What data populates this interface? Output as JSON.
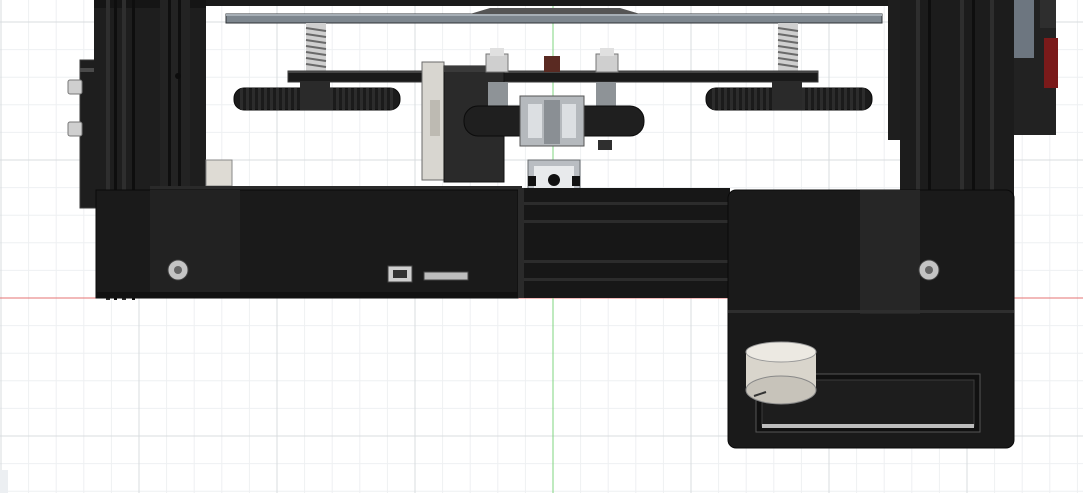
{
  "app": {
    "view": "front",
    "grid_visible": true
  },
  "colors": {
    "background": "#ffffff",
    "grid_minor": "#eef0f2",
    "grid_major": "#d8dcdf",
    "x_axis": "#e57373",
    "y_axis": "#7fd47f",
    "frame": "#1c1c1c",
    "panel": "#1a1a1a",
    "panel_highlight": "#2a2a2a",
    "glass_bed": "#7d868e",
    "accent_red": "#7a1a1a",
    "aluminum": "#b9bdc2",
    "spring": "#9a9a9a",
    "knob": "#d9d5cc"
  },
  "parts": [
    "left-frame-rail",
    "right-frame-rail",
    "glass-bed",
    "bed-carriage-plate",
    "leveling-spring-left",
    "leveling-spring-right",
    "leveling-wheel-left",
    "leveling-wheel-right",
    "y-axis-motor",
    "y-axis-idler-pulley",
    "aluminum-extrusion",
    "base-enclosure",
    "control-box",
    "lcd-panel",
    "control-knob",
    "power-switch"
  ]
}
